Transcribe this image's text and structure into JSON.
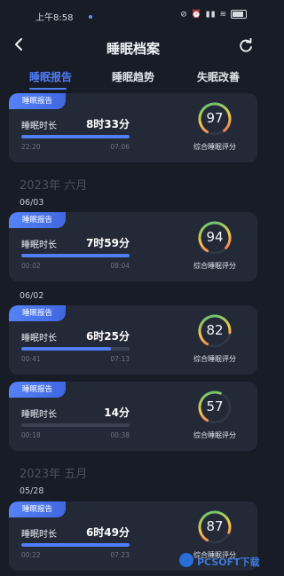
{
  "status_bar": {
    "time": "上午8:58",
    "right_icons": [
      "dnd-icon",
      "alarm-icon",
      "signal-icon",
      "wifi-icon",
      "battery-icon"
    ]
  },
  "header": {
    "title": "睡眠档案"
  },
  "tabs": [
    {
      "label": "睡眠报告",
      "active": true
    },
    {
      "label": "睡眠趋势",
      "active": false
    },
    {
      "label": "失眠改善",
      "active": false
    }
  ],
  "months": [
    "2023年 六月",
    "2023年 五月"
  ],
  "dates": [
    "06/03",
    "06/02",
    "05/28"
  ],
  "common": {
    "tag": "睡眠报告",
    "duration_label": "睡眠时长",
    "score_label": "综合睡眠评分"
  },
  "cards": [
    {
      "duration": "8时33分",
      "start": "22:20",
      "end": "07:06",
      "progress": 1.0,
      "score": "97"
    },
    {
      "duration": "7时59分",
      "start": "00:02",
      "end": "08:04",
      "progress": 1.0,
      "score": "94"
    },
    {
      "duration": "6时25分",
      "start": "00:41",
      "end": "07:13",
      "progress": 0.83,
      "score": "82"
    },
    {
      "duration": "14分",
      "start": "00:18",
      "end": "00:38",
      "progress": 0.0,
      "score": "57"
    },
    {
      "duration": "6时49分",
      "start": "00:22",
      "end": "07:23",
      "progress": 1.0,
      "score": "87"
    }
  ],
  "colors": {
    "accent": "#4f7ef7",
    "ring_start": "#3fc27a",
    "ring_mid": "#f5c84a",
    "ring_end": "#ef5a5a"
  },
  "watermark": "PCSOFT下载"
}
